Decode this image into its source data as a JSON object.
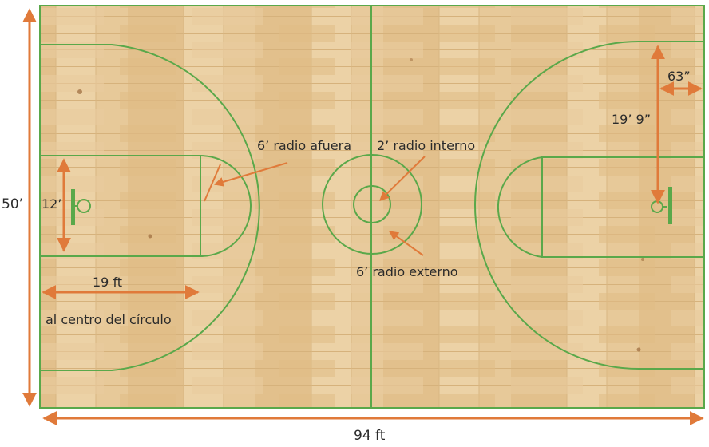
{
  "court": {
    "floor_color": "#e7c999",
    "line_color": "#5aa84a",
    "arrow_color": "#e07a3a"
  },
  "labels": {
    "outer_radius": "6’ radio afuera",
    "inner_radius": "2’ radio interno",
    "external_radius": "6’ radio externo",
    "lane_width": "12’",
    "free_throw_distance": "19 ft",
    "to_circle_center": "al centro del círculo",
    "three_point_distance": "19’ 9”",
    "baseline_offset": "63”",
    "court_width": "50’",
    "court_length": "94 ft"
  }
}
